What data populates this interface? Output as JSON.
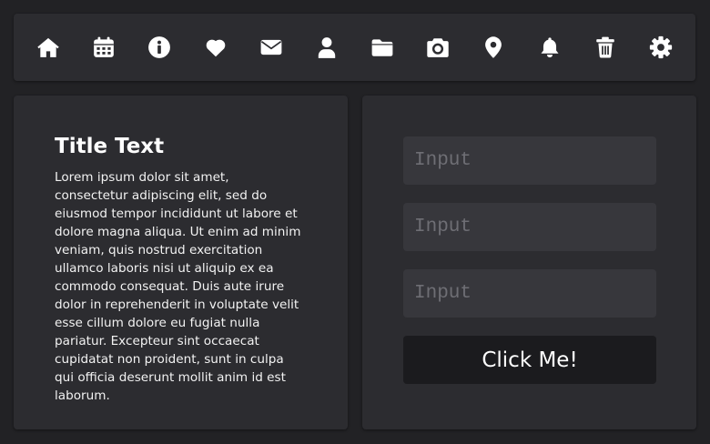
{
  "colors": {
    "background": "#222225",
    "panel": "#2c2c30",
    "input": "#37373c",
    "button": "#1b1b1e",
    "icon": "#ffffff"
  },
  "toolbar": {
    "icons": [
      "home-icon",
      "calendar-icon",
      "info-icon",
      "heart-icon",
      "mail-icon",
      "user-icon",
      "folder-icon",
      "camera-icon",
      "location-pin-icon",
      "bell-icon",
      "trash-icon",
      "gear-icon"
    ]
  },
  "content": {
    "title": "Title Text",
    "body": "Lorem ipsum dolor sit amet, consectetur adipiscing elit, sed do eiusmod tempor incididunt ut labore et dolore magna aliqua. Ut enim ad minim veniam, quis nostrud exercitation ullamco laboris nisi ut aliquip ex ea commodo consequat. Duis aute irure dolor in reprehenderit in voluptate velit esse cillum dolore eu fugiat nulla pariatur. Excepteur sint occaecat cupidatat non proident, sunt in culpa qui officia deserunt mollit anim id est laborum."
  },
  "form": {
    "input1": {
      "value": "",
      "placeholder": "Input"
    },
    "input2": {
      "value": "",
      "placeholder": "Input"
    },
    "input3": {
      "value": "",
      "placeholder": "Input"
    },
    "button_label": "Click Me!"
  }
}
